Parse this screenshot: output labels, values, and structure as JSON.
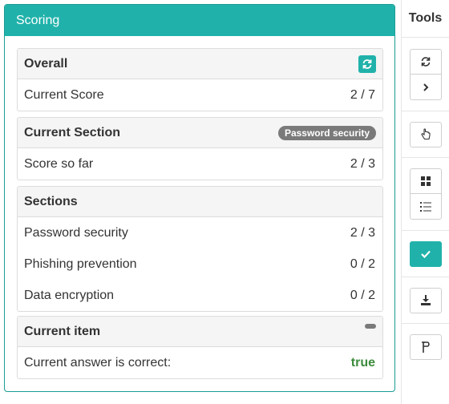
{
  "scoring": {
    "title": "Scoring",
    "overall": {
      "header": "Overall",
      "label": "Current Score",
      "value": "2 / 7"
    },
    "current_section": {
      "header": "Current Section",
      "badge": "Password security",
      "label": "Score so far",
      "value": "2 / 3"
    },
    "sections": {
      "header": "Sections",
      "items": [
        {
          "label": "Password security",
          "value": "2 / 3"
        },
        {
          "label": "Phishing prevention",
          "value": "0 / 2"
        },
        {
          "label": "Data encryption",
          "value": "0 / 2"
        }
      ]
    },
    "current_item": {
      "header": "Current item",
      "label": "Current answer is correct:",
      "value": "true"
    }
  },
  "tools": {
    "title": "Tools",
    "buttons": [
      {
        "icon": "refresh-icon"
      },
      {
        "icon": "chevron-right-icon"
      },
      {
        "icon": "pointer-hand-icon"
      },
      {
        "icon": "grid-view-icon"
      },
      {
        "icon": "list-view-icon"
      },
      {
        "icon": "check-icon"
      },
      {
        "icon": "download-icon"
      },
      {
        "icon": "p-tool-icon"
      }
    ]
  },
  "colors": {
    "accent": "#20b2aa",
    "badge": "#7a7a7a",
    "true_text": "#3c8c3c"
  }
}
